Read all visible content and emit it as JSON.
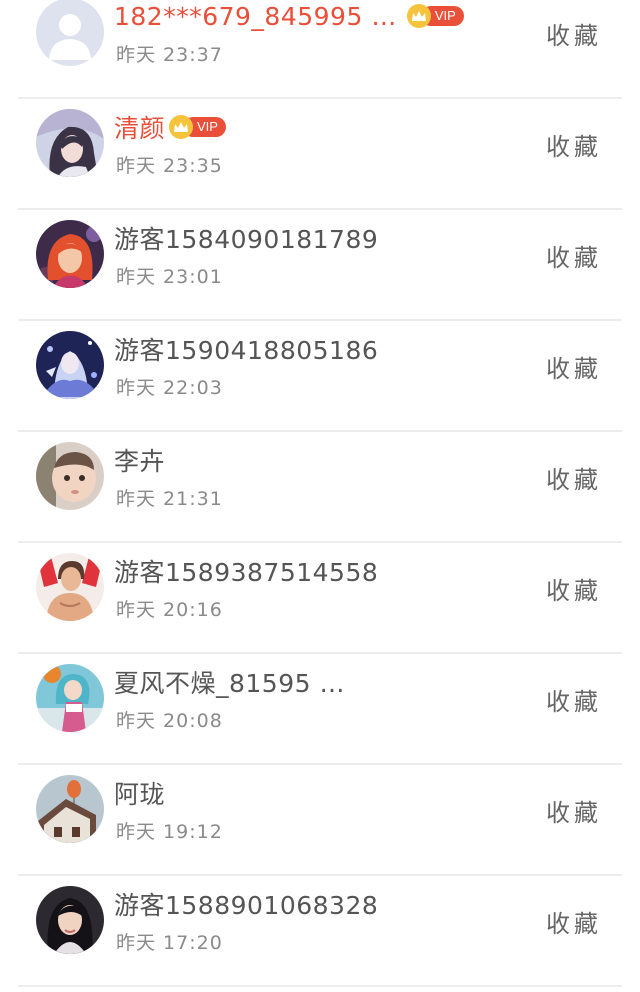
{
  "rows": [
    {
      "name": "182***679_845995 …",
      "time": "昨天 23:37",
      "vip": true,
      "vip_label": "VIP",
      "action": "收藏",
      "avatar": "default"
    },
    {
      "name": "清颜",
      "time": "昨天 23:35",
      "vip": true,
      "vip_label": "VIP",
      "action": "收藏",
      "avatar": "anime-girl"
    },
    {
      "name": "游客1584090181789",
      "time": "昨天 23:01",
      "vip": false,
      "action": "收藏",
      "avatar": "redhead"
    },
    {
      "name": "游客1590418805186",
      "time": "昨天 22:03",
      "vip": false,
      "action": "收藏",
      "avatar": "blue-art"
    },
    {
      "name": "李卉",
      "time": "昨天 21:31",
      "vip": false,
      "action": "收藏",
      "avatar": "baby"
    },
    {
      "name": "游客1589387514558",
      "time": "昨天 20:16",
      "vip": false,
      "action": "收藏",
      "avatar": "fighter"
    },
    {
      "name": "夏风不燥_81595 …",
      "time": "昨天 20:08",
      "vip": false,
      "action": "收藏",
      "avatar": "game-girl"
    },
    {
      "name": "阿珑",
      "time": "昨天 19:12",
      "vip": false,
      "action": "收藏",
      "avatar": "balloon-house"
    },
    {
      "name": "游客1588901068328",
      "time": "昨天 17:20",
      "vip": false,
      "action": "收藏",
      "avatar": "woman"
    }
  ],
  "colors": {
    "vip_name": "#ea4f3a",
    "vip_crown": "#f6c33c",
    "vip_tag": "#ea4f3a",
    "name": "#555555",
    "time": "#8a8a8a",
    "divider": "#ececec"
  }
}
